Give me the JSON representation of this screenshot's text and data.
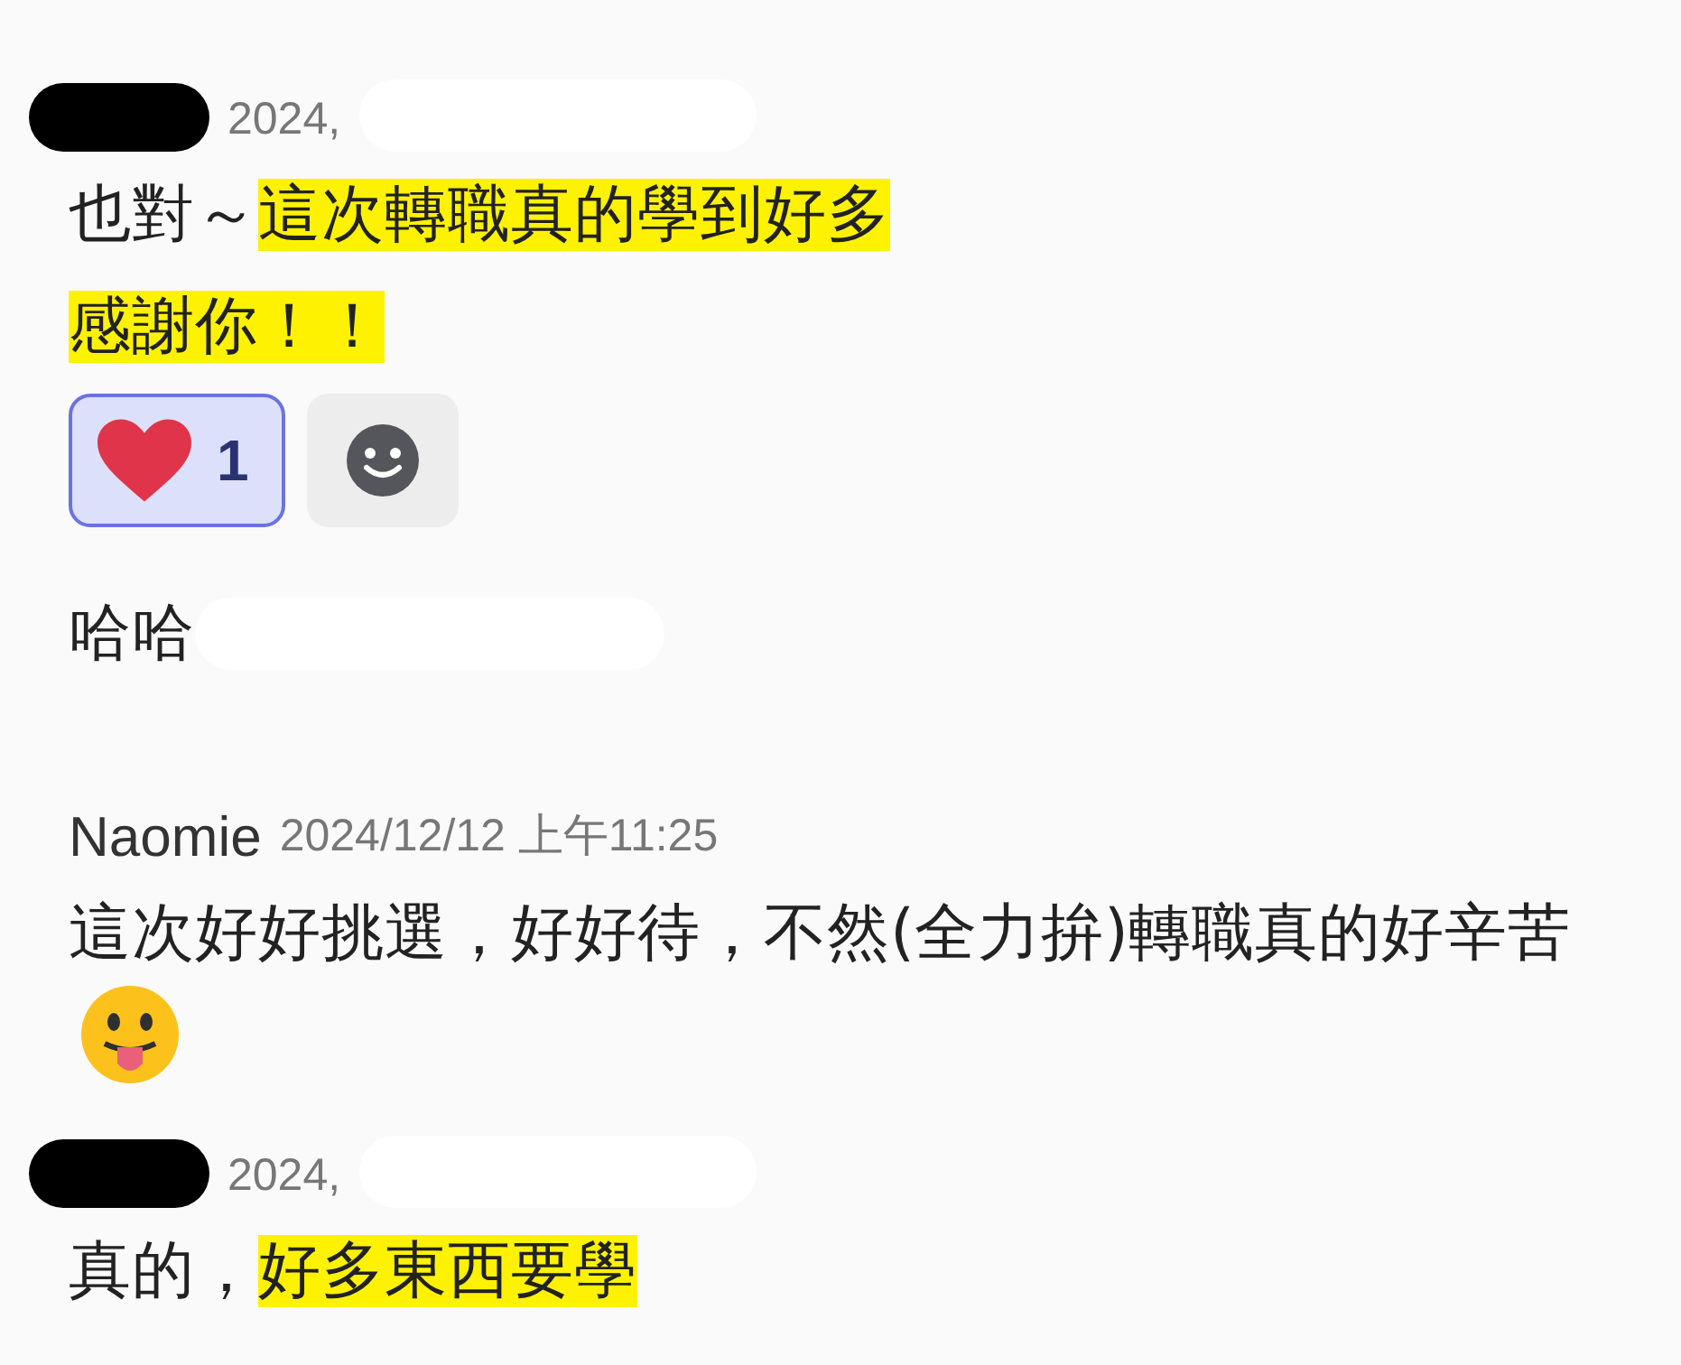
{
  "messages": [
    {
      "author": {
        "kind": "redacted"
      },
      "time": "2024,",
      "paragraphs": [
        [
          {
            "text": "也對～",
            "highlighted": false
          },
          {
            "text": "這次轉職真的學到好多",
            "highlighted": true
          }
        ],
        [
          {
            "text": "感謝你！！",
            "highlighted": true
          }
        ]
      ],
      "reactions": [
        {
          "kind": "heart",
          "count": "1",
          "selected": true
        },
        {
          "kind": "add"
        }
      ]
    },
    {
      "paragraphs": [
        [
          {
            "text": "哈哈",
            "highlighted": false
          },
          {
            "kind": "redaction"
          }
        ]
      ]
    },
    {
      "author": {
        "kind": "name",
        "name": "Naomie"
      },
      "time": "2024/12/12 上午11:25",
      "paragraphs": [
        [
          {
            "text": "這次好好挑選，好好待，不然(全力拚)轉職真的好辛苦",
            "highlighted": false
          },
          {
            "kind": "emoji"
          }
        ]
      ]
    },
    {
      "author": {
        "kind": "redacted"
      },
      "time": "2024,",
      "paragraphs": [
        [
          {
            "text": "真的，",
            "highlighted": false
          },
          {
            "text": "好多東西要學",
            "highlighted": true
          }
        ]
      ]
    }
  ]
}
